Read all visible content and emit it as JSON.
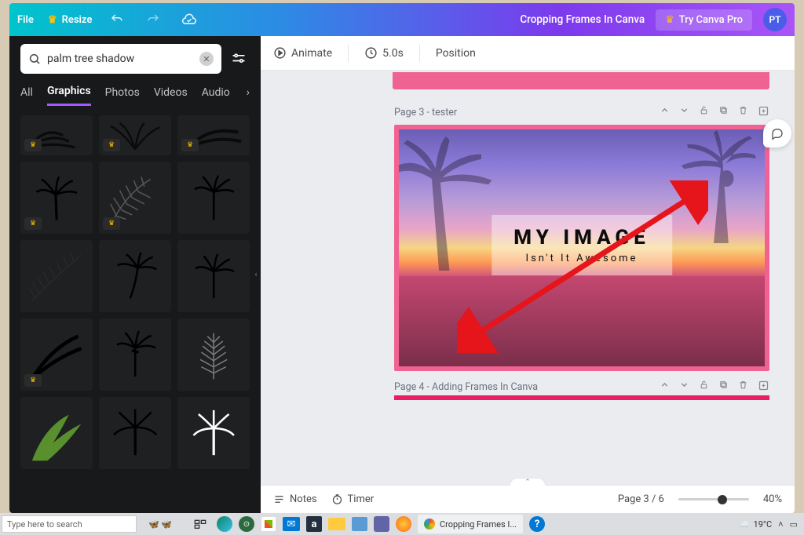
{
  "topbar": {
    "file": "File",
    "resize": "Resize",
    "doc_title": "Cropping Frames In Canva",
    "try_pro": "Try Canva Pro",
    "avatar": "PT"
  },
  "search": {
    "value": "palm tree shadow"
  },
  "tabs": {
    "all": "All",
    "graphics": "Graphics",
    "photos": "Photos",
    "videos": "Videos",
    "audio": "Audio"
  },
  "context": {
    "animate": "Animate",
    "duration": "5.0s",
    "position": "Position"
  },
  "pages": {
    "page3_label": "Page 3 - tester",
    "page4_label": "Page 4 - Adding Frames In Canva"
  },
  "design": {
    "title": "MY IMAGE",
    "subtitle": "Isn't It Awesome"
  },
  "bottom": {
    "notes": "Notes",
    "timer": "Timer",
    "page_display": "Page 3 / 6",
    "zoom": "40%"
  },
  "taskbar": {
    "search_placeholder": "Type here to search",
    "window_title": "Cropping Frames I...",
    "temp": "19°C"
  }
}
